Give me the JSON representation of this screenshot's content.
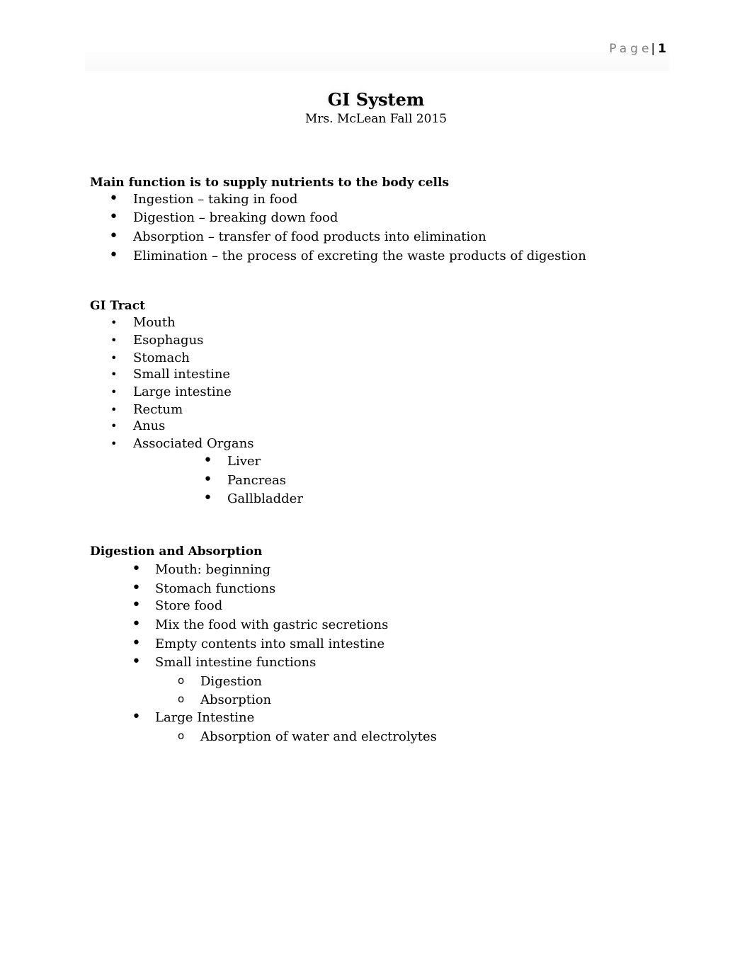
{
  "header": {
    "page_label": "Page",
    "separator": "|",
    "page_number": "1"
  },
  "title": "GI System",
  "subtitle": "Mrs. McLean Fall 2015",
  "sections": [
    {
      "heading": "Main function is to supply nutrients to the body cells",
      "items": [
        "Ingestion – taking in food",
        "Digestion – breaking down food",
        "Absorption – transfer of food products into elimination",
        "Elimination – the process of excreting the waste products of digestion"
      ]
    },
    {
      "heading": "GI Tract",
      "items": [
        "Mouth",
        "Esophagus",
        "Stomach",
        "Small intestine",
        "Large intestine",
        "Rectum",
        "Anus",
        "Associated Organs"
      ],
      "subitems": [
        "Liver",
        "Pancreas",
        "Gallbladder"
      ]
    },
    {
      "heading": "Digestion and Absorption",
      "items": [
        "Mouth: beginning",
        "Stomach functions",
        "Store food",
        "Mix the food with gastric secretions",
        "Empty contents into small intestine",
        "Small intestine functions",
        "Digestion",
        "Absorption",
        "Large Intestine",
        "Absorption of water and electrolytes"
      ]
    }
  ],
  "bullet_glyphs": {
    "disc": "•",
    "circle": "o"
  }
}
